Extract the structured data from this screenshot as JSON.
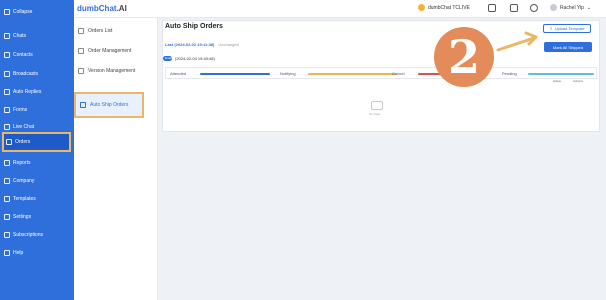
{
  "app": {
    "brand": "dumbChat",
    "brand_suffix": ".AI"
  },
  "header": {
    "company": "dumbChat TCLIVE",
    "user": "Rachel Yip"
  },
  "sidebar": {
    "items": [
      {
        "label": "Collapse",
        "icon": "menu-icon"
      },
      {
        "label": "Chats",
        "icon": "chat-icon"
      },
      {
        "label": "Contacts",
        "icon": "user-icon"
      },
      {
        "label": "Broadcasts",
        "icon": "broadcast-icon"
      },
      {
        "label": "Auto Replies",
        "icon": "reply-icon"
      },
      {
        "label": "Forms",
        "icon": "form-icon"
      },
      {
        "label": "Live Chat",
        "icon": "live-icon"
      },
      {
        "label": "Orders",
        "icon": "orders-icon",
        "active": true
      },
      {
        "label": "Reports",
        "icon": "report-icon"
      },
      {
        "label": "Company",
        "icon": "company-icon"
      },
      {
        "label": "Templates",
        "icon": "template-icon"
      },
      {
        "label": "Settings",
        "icon": "settings-icon"
      },
      {
        "label": "Subscriptions",
        "icon": "subscription-icon"
      },
      {
        "label": "Help",
        "icon": "help-icon"
      }
    ]
  },
  "subnav": {
    "items": [
      {
        "label": "Orders List",
        "icon": "list-icon"
      },
      {
        "label": "Order Management",
        "icon": "manage-icon"
      },
      {
        "label": "Version Management",
        "icon": "version-icon"
      },
      {
        "label": "Auto Ship Orders",
        "icon": "document-icon",
        "active": true
      }
    ]
  },
  "panel": {
    "title": "Auto Ship Orders",
    "last_update": "Last (2024-02-02 19:11:38)",
    "last_update_note": "Unchanged",
    "toggle_label": "Enabled",
    "toggle_date": "(2024-02-04 19:40:48)",
    "upload_button": "Upload Template",
    "all_button": "Mark All Shipped",
    "status_columns": [
      {
        "label": "Attended",
        "color": "#2f6fdc"
      },
      {
        "label": "Notifying",
        "color": "#e9b84a"
      },
      {
        "label": "Cancel",
        "color": "#d9534f"
      },
      {
        "label": "Pending",
        "color": "#5bc0de"
      }
    ],
    "right_col_1": "status",
    "right_col_2": "Actions",
    "empty_text": "No Data"
  },
  "annotation": {
    "step": "2"
  }
}
